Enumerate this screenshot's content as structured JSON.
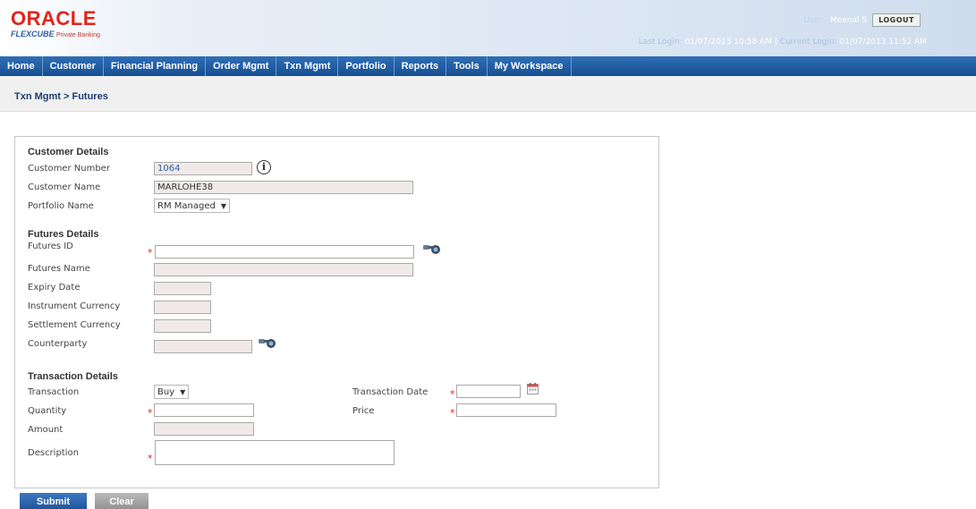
{
  "header": {
    "logo_text": "ORACLE",
    "logo_sub": "FLEXCUBE",
    "logo_sub2": "Private Banking",
    "user_label": "User:",
    "user_name": "Meenal S",
    "logout_label": "LOGOUT",
    "last_login_label": "Last Login:",
    "last_login_value": "01/07/2013 10:58 AM",
    "current_login_label": "Current Login:",
    "current_login_value": "01/07/2013 11:52 AM"
  },
  "nav": {
    "items": [
      "Home",
      "Customer",
      "Financial Planning",
      "Order Mgmt",
      "Txn Mgmt",
      "Portfolio",
      "Reports",
      "Tools",
      "My Workspace"
    ]
  },
  "breadcrumb": "Txn Mgmt > Futures",
  "customer": {
    "title": "Customer Details",
    "number_label": "Customer Number",
    "number_value": "1064",
    "name_label": "Customer Name",
    "name_value": "MARLOHE38",
    "portfolio_label": "Portfolio Name",
    "portfolio_value": "RM Managed"
  },
  "futures": {
    "title": "Futures Details",
    "id_label": "Futures ID",
    "name_label": "Futures Name",
    "expiry_label": "Expiry Date",
    "instr_ccy_label": "Instrument Currency",
    "settle_ccy_label": "Settlement Currency",
    "counterparty_label": "Counterparty"
  },
  "transaction": {
    "title": "Transaction Details",
    "transaction_label": "Transaction",
    "transaction_value": "Buy",
    "date_label": "Transaction Date",
    "quantity_label": "Quantity",
    "price_label": "Price",
    "amount_label": "Amount",
    "description_label": "Description",
    "required_mark": "*"
  },
  "buttons": {
    "submit": "Submit",
    "clear": "Clear"
  },
  "colors": {
    "nav_bg": "#1f5aa0",
    "oracle_red": "#e2231a",
    "required": "#e2231a",
    "readonly_field": "#f1e9e9"
  }
}
